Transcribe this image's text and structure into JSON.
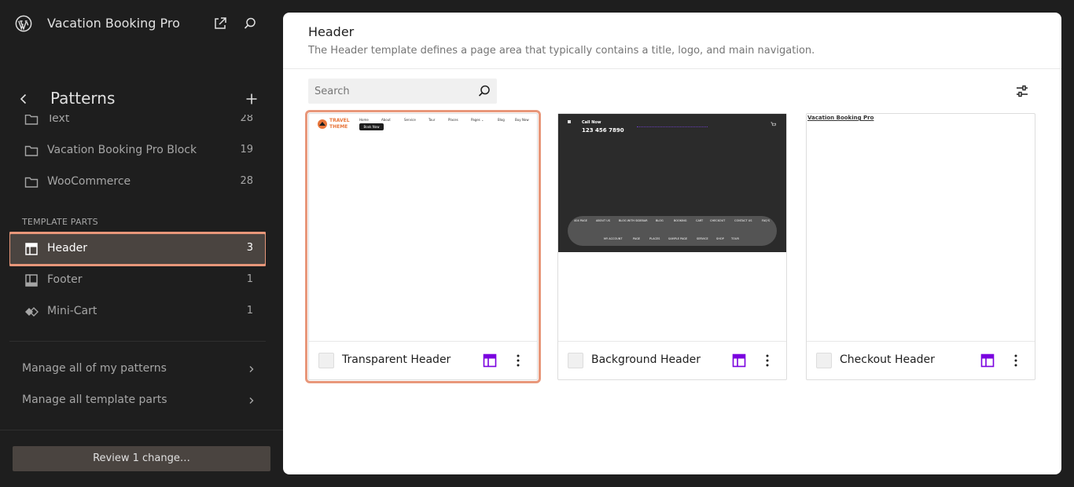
{
  "site": {
    "title": "Vacation Booking Pro"
  },
  "sidebar": {
    "title": "Patterns",
    "categories": [
      {
        "label": "Text",
        "count": "28"
      },
      {
        "label": "Vacation Booking Pro Block",
        "count": "19"
      },
      {
        "label": "WooCommerce",
        "count": "28"
      }
    ],
    "section_label": "TEMPLATE PARTS",
    "template_parts": [
      {
        "label": "Header",
        "count": "3"
      },
      {
        "label": "Footer",
        "count": "1"
      },
      {
        "label": "Mini-Cart",
        "count": "1"
      }
    ],
    "manage_links": [
      {
        "label": "Manage all of my patterns"
      },
      {
        "label": "Manage all template parts"
      }
    ],
    "review_button": "Review 1 change…"
  },
  "main": {
    "title": "Header",
    "description": "The Header template defines a page area that typically contains a title, logo, and main navigation.",
    "search_placeholder": "Search",
    "cards": [
      {
        "name": "Transparent Header",
        "preview": {
          "logo_line1": "TRAVEL",
          "logo_line2": "THEME",
          "nav": [
            "Home",
            "About",
            "Service",
            "Tour",
            "Places",
            "Pages ⌄",
            "Blog",
            "Buy Now"
          ],
          "cta": "Book Now"
        }
      },
      {
        "name": "Background Header",
        "preview": {
          "call_label": "Call Now",
          "phone": "123 456 7890",
          "nav_row1": [
            "404 PAGE",
            "ABOUT US",
            "BLOG WITH SIDEBAR",
            "BLOG",
            "BOOKING",
            "CART",
            "CHECKOUT",
            "CONTACT US",
            "FAQ'S"
          ],
          "nav_row2": [
            "MY ACCOUNT",
            "PAGE",
            "PLACES",
            "SAMPLE PAGE",
            "SERVICE",
            "SHOP",
            "TOUR"
          ]
        }
      },
      {
        "name": "Checkout Header",
        "preview": {
          "site_link": "Vacation Booking Pro"
        }
      }
    ]
  },
  "colors": {
    "accent": "#e8977a",
    "template_icon": "#7a00df",
    "sidebar_bg": "#1e1e1e"
  }
}
